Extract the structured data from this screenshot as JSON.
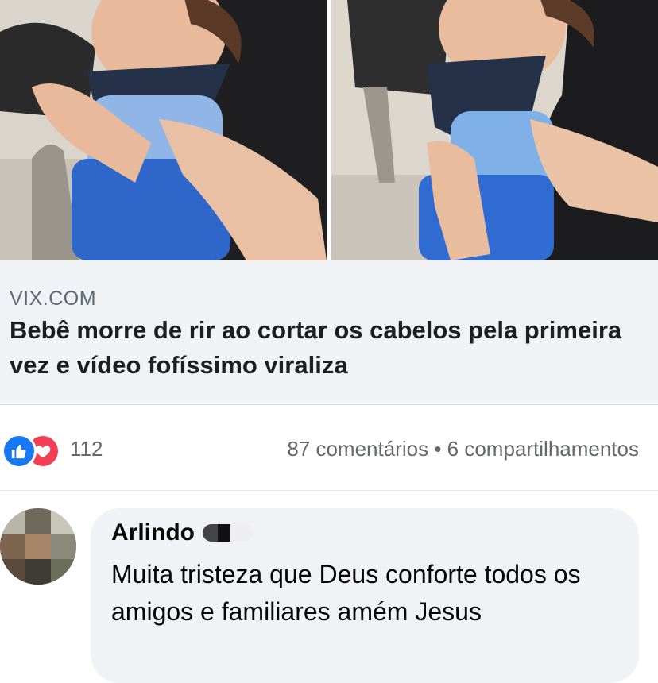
{
  "post": {
    "link_preview": {
      "source": "VIX.COM",
      "headline": "Bebê morre de rir ao cortar os cabelos pela primeira vez e vídeo fofíssimo viraliza"
    },
    "reactions": {
      "count": "112",
      "icons": [
        "like-icon",
        "love-icon"
      ],
      "comments": "87 comentários",
      "separator": "•",
      "shares": "6 compartilhamentos"
    }
  },
  "comment": {
    "author": "Arlindo",
    "text": "Muita tristeza que Deus conforte todos os amigos e familiares amém Jesus"
  },
  "colors": {
    "like": "#1877f2",
    "love": "#f33e58",
    "card_bg": "#f0f2f5",
    "muted_text": "#65676b"
  }
}
